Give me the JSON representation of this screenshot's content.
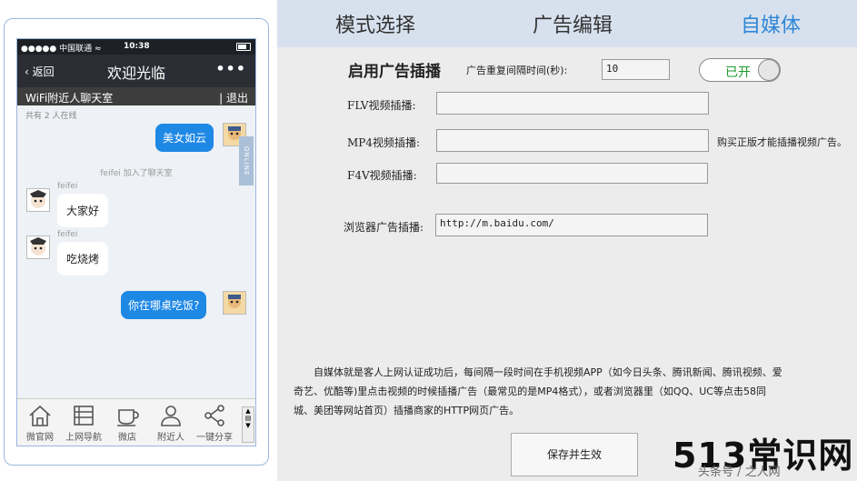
{
  "phone": {
    "status": {
      "carrier": "●●●●● 中国联通 ≈",
      "time": "10:38"
    },
    "nav": {
      "back": "返回",
      "title": "欢迎光临",
      "more": "•••"
    },
    "room": {
      "name": "WiFi附近人聊天室",
      "exit": "| 退出"
    },
    "online_count": "共有 2 人在线",
    "online_tab": "ONLINE",
    "messages": [
      {
        "text": "美女如云"
      },
      {
        "system": "feifei 加入了聊天室"
      },
      {
        "nick": "feifei",
        "text": "大家好"
      },
      {
        "nick": "feifei",
        "text": "吃烧烤"
      },
      {
        "text": "你在哪桌吃饭?"
      }
    ],
    "tabs": [
      "微官网",
      "上网导航",
      "微店",
      "附近人",
      "一键分享"
    ]
  },
  "menu": {
    "items": [
      "模式选择",
      "广告编辑",
      "自媒体"
    ],
    "active": "自媒体"
  },
  "form": {
    "heading": "启用广告插播",
    "interval_label": "广告重复间隔时间(秒):",
    "interval_value": "10",
    "toggle_label": "已开",
    "flv_label": "FLV视频插播:",
    "flv_value": "",
    "mp4_label": "MP4视频插播:",
    "mp4_value": "",
    "mp4_note": "购买正版才能插播视频广告。",
    "f4v_label": "F4V视频插播:",
    "f4v_value": "",
    "browser_label": "浏览器广告插播:",
    "browser_value": "http://m.baidu.com/"
  },
  "description": "自媒体就是客人上网认证成功后，每间隔一段时间在手机视频APP（如今日头条、腾讯新闻、腾讯视频、爱奇艺、优酷等)里点击视频的时候插播广告（最常见的是MP4格式），或者浏览器里（如QQ、UC等点击58同城、美团等网站首页）插播商家的HTTP网页广告。",
  "save_button": "保存并生效",
  "watermark": {
    "main": "513常识网",
    "sub": "头条号 / 之人网"
  },
  "colors": {
    "accent": "#2f86d6",
    "bubble": "#1e88e5",
    "toggle_on": "#1d9a2a"
  }
}
